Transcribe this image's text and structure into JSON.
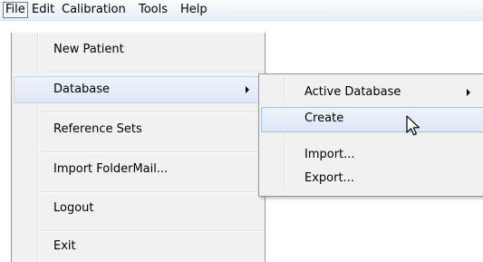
{
  "menubar": {
    "file": "File",
    "edit": "Edit",
    "calibration": "Calibration",
    "tools": "Tools",
    "help": "Help"
  },
  "file_menu": {
    "new_patient": "New Patient",
    "database": "Database",
    "reference_sets": "Reference Sets",
    "import_foldermail": "Import FolderMail...",
    "logout": "Logout",
    "exit": "Exit"
  },
  "database_submenu": {
    "active_database": "Active Database",
    "create": "Create",
    "import": "Import...",
    "export": "Export..."
  },
  "icons": {
    "submenu_arrow": "submenu-arrow-icon",
    "cursor": "mouse-cursor-icon"
  }
}
